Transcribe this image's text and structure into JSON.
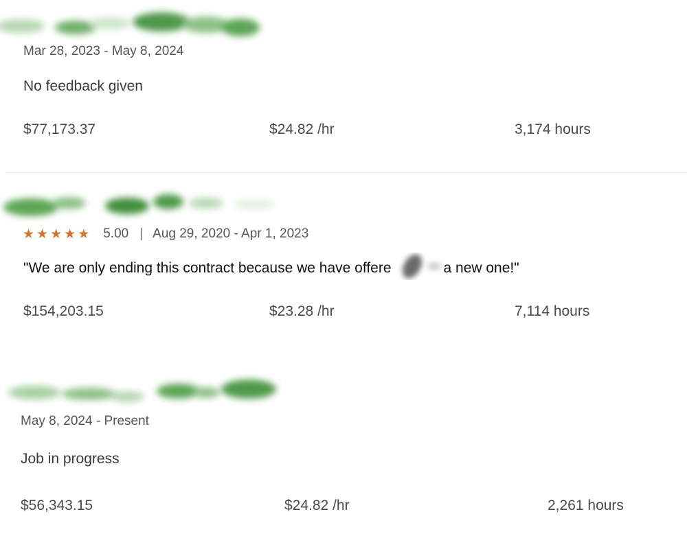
{
  "jobs": [
    {
      "dates": "Mar 28, 2023 - May 8, 2024",
      "feedback": "No feedback given",
      "earned": "$77,173.37",
      "rate": "$24.82 /hr",
      "hours": "3,174 hours"
    },
    {
      "rating": {
        "stars": 5,
        "score": "5.00"
      },
      "separator": "|",
      "dates": "Aug 29, 2020 - Apr 1, 2023",
      "feedback_before": "\"We are only ending this contract because we have offere",
      "feedback_after": "a new one!\"",
      "earned": "$154,203.15",
      "rate": "$23.28 /hr",
      "hours": "7,114 hours"
    },
    {
      "dates": "May 8, 2024 - Present",
      "feedback": "Job in progress",
      "earned": "$56,343.15",
      "rate": "$24.82 /hr",
      "hours": "2,261 hours"
    }
  ],
  "colors": {
    "star": "#d9732b",
    "redaction_green": "#4f9a4a",
    "redaction_gray": "#6b6b6b"
  },
  "icons": {
    "star": "star-icon"
  }
}
